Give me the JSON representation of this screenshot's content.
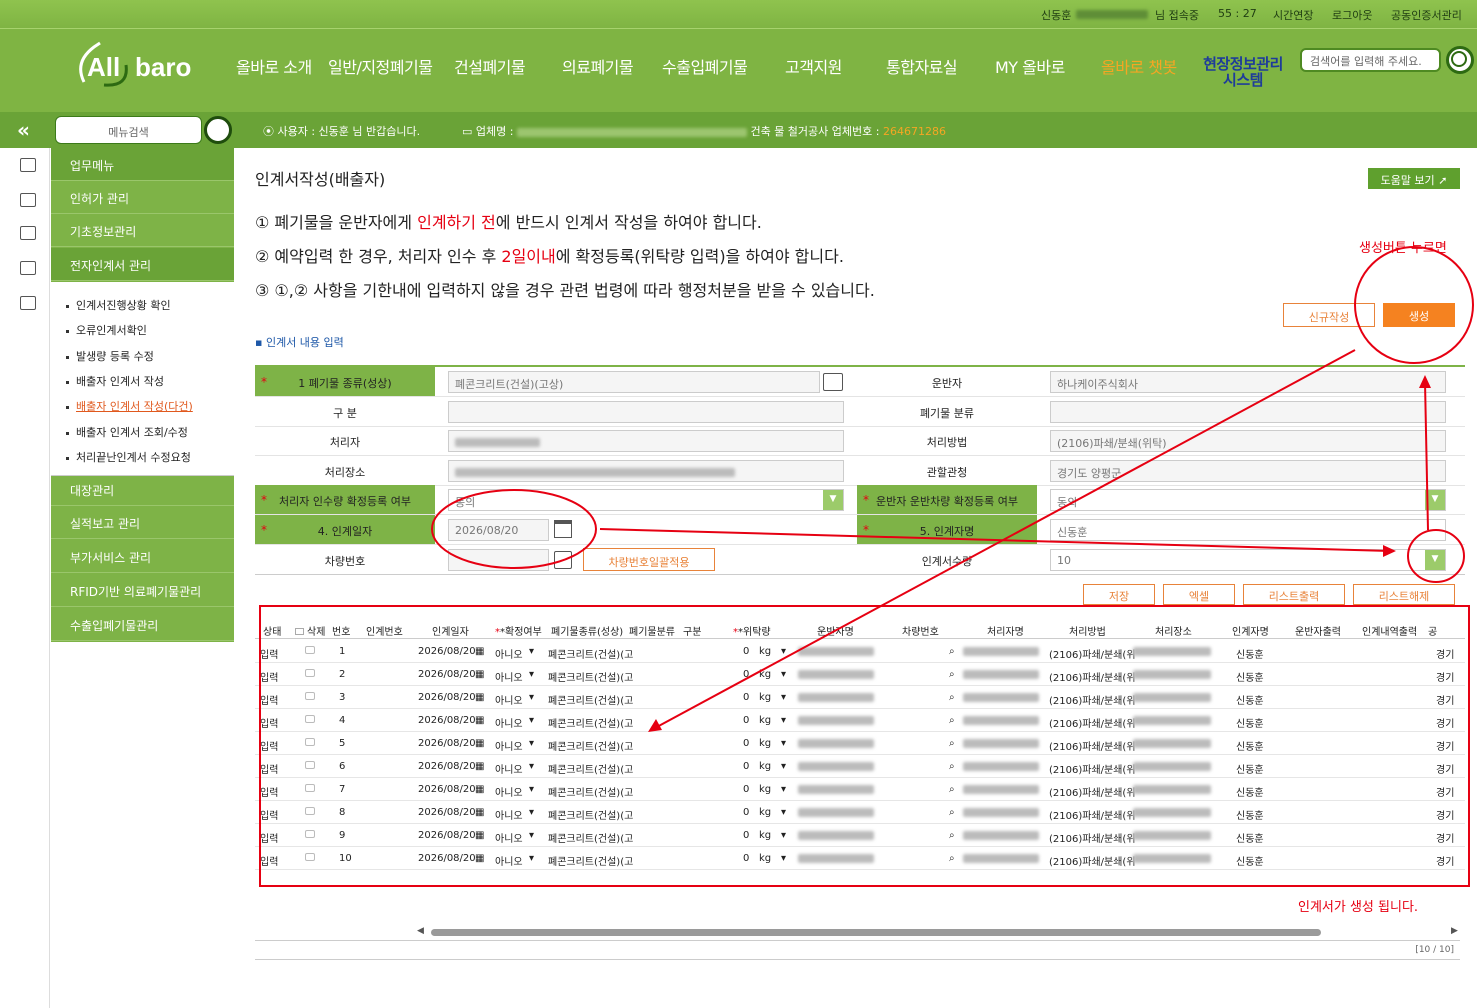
{
  "topbar": {
    "user_name": "신동훈",
    "status": "님 접속중",
    "timer": "55 : 27",
    "extend": "시간연장",
    "logout": "로그아웃",
    "cert": "공동인증서관리"
  },
  "header": {
    "logo_text": "All baro",
    "nav": [
      "올바로 소개",
      "일반/지정폐기물",
      "건설폐기물",
      "의료폐기물",
      "수출입폐기물",
      "고객지원",
      "통합자료실",
      "MY 올바로",
      "올바로 챗봇",
      "현장정보관리 시스템"
    ],
    "search_placeholder": "검색어를 입력해 주세요."
  },
  "subbar": {
    "menu_search_placeholder": "메뉴검색",
    "user_label": "사용자 : 신동훈 님 반갑습니다.",
    "company_label": "업체명 :",
    "company_suffix": "건축 물 철거공사",
    "company_no_label": "업체번호 :",
    "company_no": "264671286"
  },
  "sidebar": {
    "items": [
      "업무메뉴",
      "인허가 관리",
      "기초정보관리",
      "전자인계서 관리"
    ],
    "sub_items": [
      "인계서진행상황 확인",
      "오류인계서확인",
      "발생량 등록 수정",
      "배출자 인계서 작성",
      "배출자 인계서 작성(다건)",
      "배출자 인계서 조회/수정",
      "처리끝난인계서 수정요청"
    ],
    "active_sub": "배출자 인계서 작성(다건)",
    "bottom_items": [
      "대장관리",
      "실적보고 관리",
      "부가서비스 관리",
      "RFID기반 의료폐기물관리",
      "수출입폐기물관리"
    ]
  },
  "page": {
    "title": "인계서작성(배출자)",
    "help_button": "도움말 보기",
    "notice1_a": "① 폐기물을 운반자에게 ",
    "notice1_red": "인계하기 전",
    "notice1_b": "에 반드시 인계서 작성을 하여야 합니다.",
    "notice2_a": "② 예약입력 한 경우, 처리자 인수 후 ",
    "notice2_red": "2일이내",
    "notice2_b": "에 확정등록(위탁량 입력)을 하여야 합니다.",
    "notice3": "③ ①,② 사항을 기한내에 입력하지 않을 경우 관련 법령에 따라 행정처분을 받을 수 있습니다.",
    "new_button": "신규작성",
    "create_button": "생성",
    "section_title": "인계서 내용 입력"
  },
  "form": {
    "waste_type_label": "1 폐기물 종류(성상)",
    "waste_type_value": "폐콘크리트(건설)(고상)",
    "carrier_label": "운반자",
    "carrier_value": "하나케이주식회사",
    "category_label": "구 분",
    "waste_class_label": "폐기물 분류",
    "processor_label": "처리자",
    "method_label": "처리방법",
    "method_value": "(2106)파쇄/분쇄(위탁)",
    "site_label": "처리장소",
    "agency_label": "관할관청",
    "agency_value": "경기도 양평군",
    "confirm_label": "처리자 인수량 확정등록 여부",
    "confirm_value": "동의",
    "carrier_confirm_label": "운반자 운반차량 확정등록 여부",
    "carrier_confirm_value": "동의",
    "date_label": "4. 인계일자",
    "date_value": "2026/08/20",
    "handler_label": "5. 인계자명",
    "handler_value": "신동훈",
    "vehicle_label": "차량번호",
    "vehicle_apply_button": "차량번호일괄적용",
    "count_label": "인계서수량",
    "count_value": "10"
  },
  "grid_buttons": [
    "저장",
    "엑셀",
    "리스트출력",
    "리스트해제"
  ],
  "grid": {
    "headers": [
      "상태",
      "삭제",
      "번호",
      "인계번호",
      "인계일자",
      "*확정여부",
      "폐기물종류(성상)",
      "폐기물분류",
      "구분",
      "*위탁량",
      "운반자명",
      "차량번호",
      "처리자명",
      "처리방법",
      "처리장소",
      "인계자명",
      "운반자출력",
      "인계내역출력",
      "공"
    ],
    "row_template": {
      "status": "입력",
      "date": "2026/08/20",
      "confirm": "아니오",
      "waste": "폐콘크리트(건설)(고",
      "qty": "0",
      "unit": "kg",
      "method": "(2106)파쇄/분쇄(위",
      "handler": "신동훈",
      "agency": "경기"
    },
    "row_numbers": [
      "1",
      "2",
      "3",
      "4",
      "5",
      "6",
      "7",
      "8",
      "9",
      "10"
    ],
    "pager": "[10 / 10]"
  },
  "annotations": {
    "press_create": "생성버튼 누르면",
    "created": "인계서가 생성 됩니다."
  },
  "colors": {
    "brand_green": "#7eb347",
    "accent_orange": "#f58220",
    "annotation_red": "#e60012"
  }
}
